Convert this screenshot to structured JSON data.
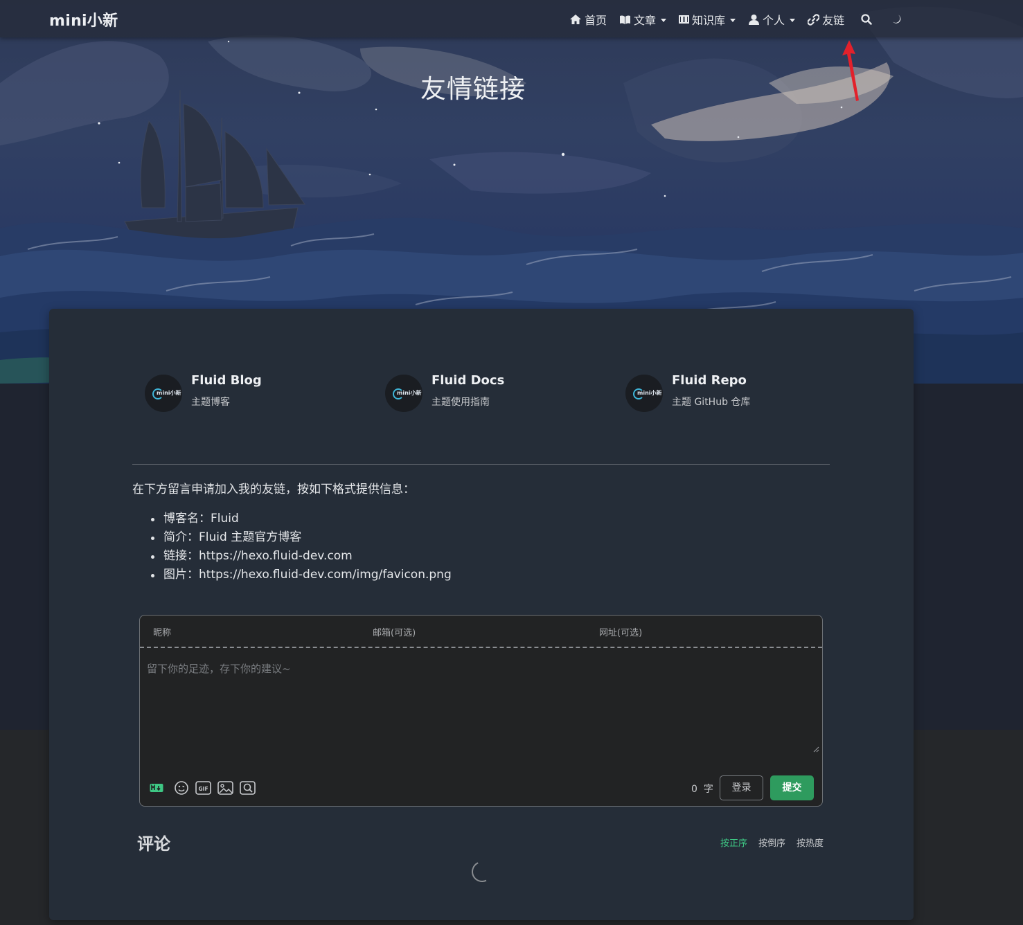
{
  "nav": {
    "brand": "mini小新",
    "items": [
      {
        "label": "首页",
        "icon": "home-icon",
        "dropdown": false
      },
      {
        "label": "文章",
        "icon": "book-icon",
        "dropdown": true
      },
      {
        "label": "知识库",
        "icon": "columns-icon",
        "dropdown": true
      },
      {
        "label": "个人",
        "icon": "user-icon",
        "dropdown": true
      },
      {
        "label": "友链",
        "icon": "link-icon",
        "dropdown": false
      }
    ],
    "search_icon": "search-icon",
    "theme_icon": "moon-icon"
  },
  "banner": {
    "title": "友情链接"
  },
  "links": [
    {
      "title": "Fluid Blog",
      "subtitle": "主题博客",
      "avatar_text": "mini小新"
    },
    {
      "title": "Fluid Docs",
      "subtitle": "主题使用指南",
      "avatar_text": "mini小新"
    },
    {
      "title": "Fluid Repo",
      "subtitle": "主题 GitHub 仓库",
      "avatar_text": "mini小新"
    }
  ],
  "apply": {
    "intro": "在下方留言申请加入我的友链，按如下格式提供信息：",
    "items": [
      "博客名：Fluid",
      "简介：Fluid 主题官方博客",
      "链接：https://hexo.fluid-dev.com",
      "图片：https://hexo.fluid-dev.com/img/favicon.png"
    ]
  },
  "comment_form": {
    "nickname_placeholder": "昵称",
    "email_placeholder": "邮箱(可选)",
    "url_placeholder": "网址(可选)",
    "textarea_placeholder": "留下你的足迹，存下你的建议~",
    "word_count": "0",
    "word_unit": "字",
    "login_label": "登录",
    "submit_label": "提交",
    "tool_icons": [
      "markdown-icon",
      "emoji-icon",
      "gif-icon",
      "image-icon",
      "preview-icon"
    ]
  },
  "comments": {
    "title": "评论",
    "sort": [
      "按正序",
      "按倒序",
      "按热度"
    ],
    "active_sort": "按正序"
  },
  "colors": {
    "accent": "#2e9b5e",
    "active_sort": "#3ec784",
    "arrow": "#e3212b"
  }
}
